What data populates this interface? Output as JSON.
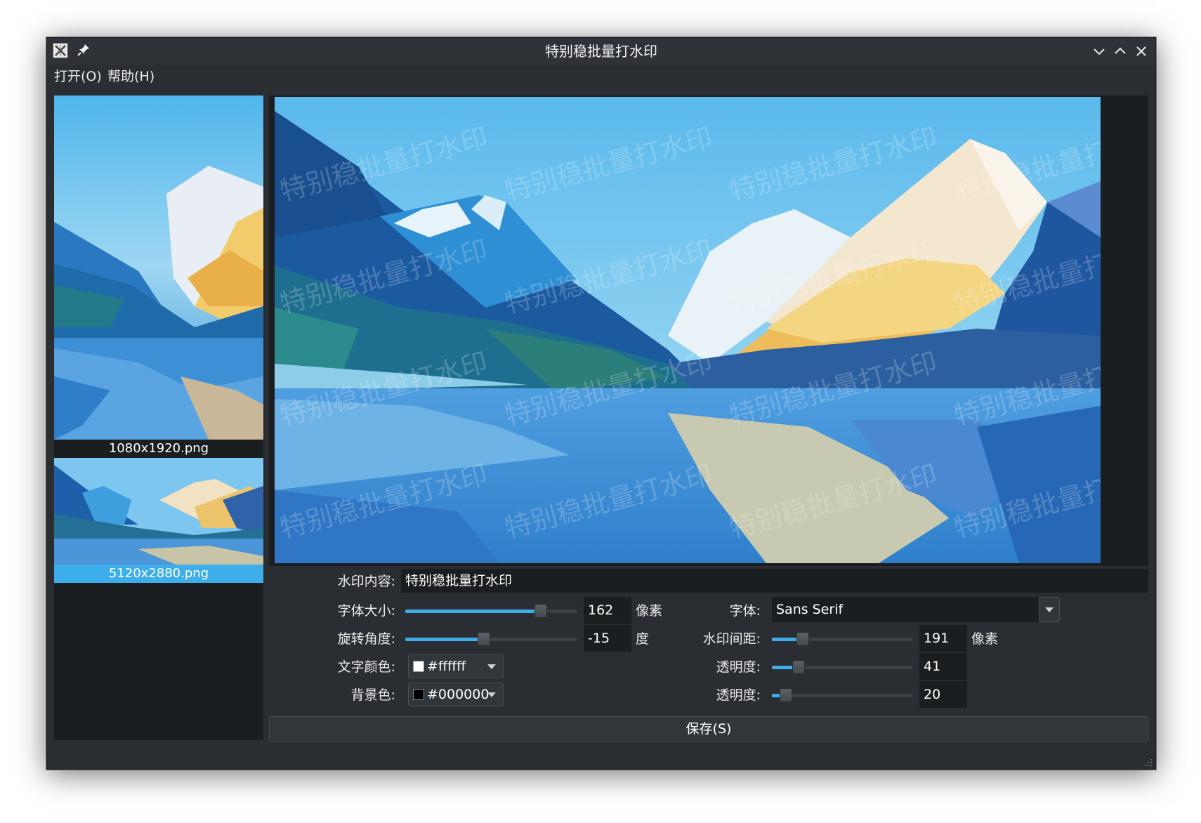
{
  "window": {
    "title": "特别稳批量打水印"
  },
  "menu": [
    {
      "label": "打开(O)"
    },
    {
      "label": "帮助(H)"
    }
  ],
  "files": [
    {
      "name": "1080x1920.png",
      "selected": false
    },
    {
      "name": "5120x2880.png",
      "selected": true
    }
  ],
  "preview": {
    "watermark_text": "特别稳批量打水印"
  },
  "controls": {
    "content_label": "水印内容:",
    "content_value": "特别稳批量打水印",
    "font_size_label": "字体大小:",
    "font_size_value": "162",
    "font_size_unit": "像素",
    "font_size_fraction": 0.79,
    "rotation_label": "旋转角度:",
    "rotation_value": "-15",
    "rotation_unit": "度",
    "rotation_fraction": 0.46,
    "text_color_label": "文字颜色:",
    "text_color_value": "#ffffff",
    "text_color_swatch": "#ffffff",
    "bg_color_label": "背景色:",
    "bg_color_value": "#000000",
    "bg_color_swatch": "#000000",
    "font_label": "字体:",
    "font_value": "Sans Serif",
    "spacing_label": "水印间距:",
    "spacing_value": "191",
    "spacing_unit": "像素",
    "spacing_fraction": 0.22,
    "opacity1_label": "透明度:",
    "opacity1_value": "41",
    "opacity1_fraction": 0.19,
    "opacity2_label": "透明度:",
    "opacity2_value": "20",
    "opacity2_fraction": 0.1,
    "save_label": "保存(S)"
  },
  "colors": {
    "accent": "#3daee9",
    "window_bg": "#2a2e32",
    "panel_bg": "#1b1e20"
  }
}
